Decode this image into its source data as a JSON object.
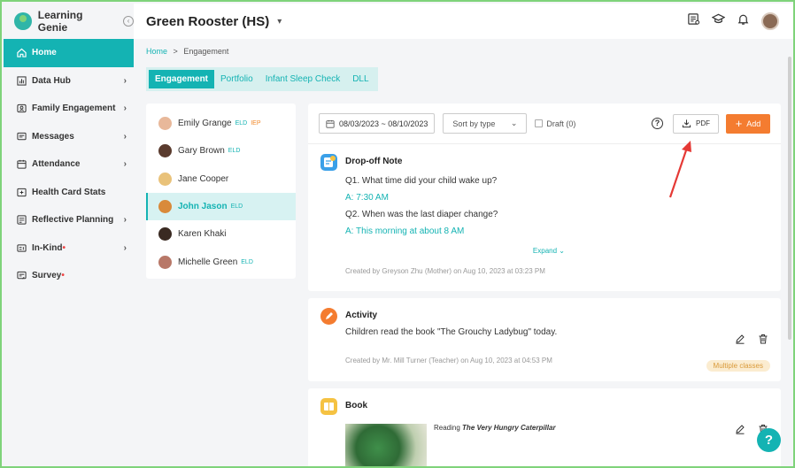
{
  "app": {
    "brand": "Learning Genie"
  },
  "sidebar": {
    "items": [
      {
        "label": "Home",
        "icon": "home-icon",
        "active": true,
        "chevron": false,
        "dot": false
      },
      {
        "label": "Data Hub",
        "icon": "chart-icon",
        "active": false,
        "chevron": true,
        "dot": false
      },
      {
        "label": "Family Engagement",
        "icon": "family-icon",
        "active": false,
        "chevron": true,
        "dot": false
      },
      {
        "label": "Messages",
        "icon": "message-icon",
        "active": false,
        "chevron": true,
        "dot": false
      },
      {
        "label": "Attendance",
        "icon": "calendar-icon",
        "active": false,
        "chevron": true,
        "dot": false
      },
      {
        "label": "Health Card Stats",
        "icon": "health-card-icon",
        "active": false,
        "chevron": false,
        "dot": false
      },
      {
        "label": "Reflective Planning",
        "icon": "planning-icon",
        "active": false,
        "chevron": true,
        "dot": false
      },
      {
        "label": "In-Kind",
        "icon": "in-kind-icon",
        "active": false,
        "chevron": true,
        "dot": true
      },
      {
        "label": "Survey",
        "icon": "survey-icon",
        "active": false,
        "chevron": false,
        "dot": true
      }
    ]
  },
  "header": {
    "title": "Green Rooster (HS)"
  },
  "breadcrumb": {
    "home": "Home",
    "sep": ">",
    "current": "Engagement"
  },
  "tabs": [
    {
      "label": "Engagement",
      "active": true
    },
    {
      "label": "Portfolio",
      "active": false
    },
    {
      "label": "Infant Sleep Check",
      "active": false
    },
    {
      "label": "DLL",
      "active": false
    }
  ],
  "children": [
    {
      "name": "Emily Grange",
      "eld": "ELD",
      "iep": "IEP",
      "active": false,
      "color": "#e8b89a"
    },
    {
      "name": "Gary Brown",
      "eld": "ELD",
      "iep": "",
      "active": false,
      "color": "#5a3b2e"
    },
    {
      "name": "Jane Cooper",
      "eld": "",
      "iep": "",
      "active": false,
      "color": "#e9c27a"
    },
    {
      "name": "John Jason",
      "eld": "ELD",
      "iep": "",
      "active": true,
      "color": "#d98a3a"
    },
    {
      "name": "Karen Khaki",
      "eld": "",
      "iep": "",
      "active": false,
      "color": "#3a2a22"
    },
    {
      "name": "Michelle Green",
      "eld": "ELD",
      "iep": "",
      "active": false,
      "color": "#b87868"
    }
  ],
  "toolbar": {
    "date_range": "08/03/2023 ~ 08/10/2023",
    "sort": "Sort by type",
    "draft": "Draft (0)",
    "help": "?",
    "pdf": "PDF",
    "add": "Add"
  },
  "cards": {
    "dropoff": {
      "title": "Drop-off Note",
      "q1": "Q1. What time did your child wake up?",
      "a1": "A: 7:30 AM",
      "q2": "Q2. When was the last diaper change?",
      "a2": "A: This morning at about 8 AM",
      "expand": "Expand",
      "created": "Created by Greyson Zhu (Mother) on Aug 10, 2023 at 03:23 PM"
    },
    "activity": {
      "title": "Activity",
      "body": "Children read the book \"The Grouchy Ladybug\" today.",
      "created": "Created by Mr. Mill Turner (Teacher) on Aug 10, 2023 at 04:53 PM",
      "badge": "Multiple classes"
    },
    "book": {
      "title": "Book",
      "reading_prefix": "Reading",
      "book_title": "The Very Hungry Caterpillar"
    }
  },
  "fab": {
    "label": "?"
  },
  "colors": {
    "accent": "#14b3b3",
    "add_button": "#f47c30",
    "annotation_arrow": "#e53935"
  }
}
